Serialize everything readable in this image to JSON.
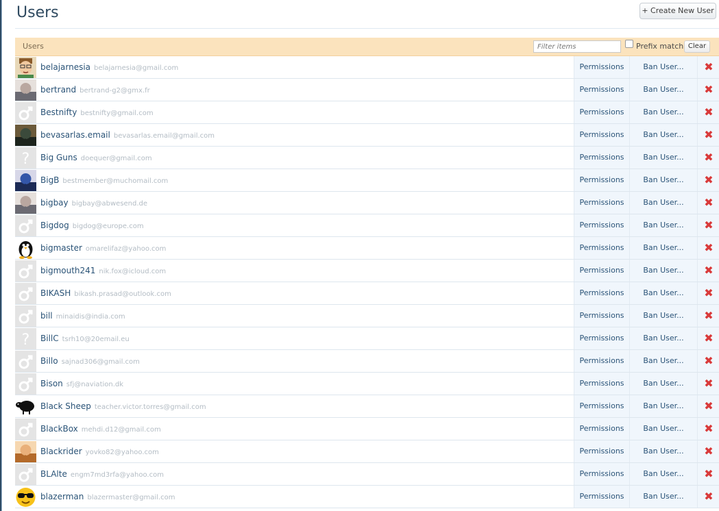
{
  "page": {
    "title": "Users",
    "create_button": "+ Create New User"
  },
  "filter": {
    "section_label": "Users",
    "placeholder": "Filter items",
    "prefix_label": "Prefix match",
    "clear_label": "Clear"
  },
  "row_actions": {
    "permissions": "Permissions",
    "ban": "Ban User...",
    "delete_icon": "red-x-icon"
  },
  "colors": {
    "accent_link": "#2a5377",
    "filter_bar": "#fbe3bd",
    "delete": "#d93a3a"
  },
  "users": [
    {
      "name": "belajarnesia",
      "email": "belajarnesia@gmail.com",
      "avatar": "cartoon-avatar"
    },
    {
      "name": "bertrand",
      "email": "bertrand-g2@gmx.fr",
      "avatar": "photo-avatar"
    },
    {
      "name": "Bestnifty",
      "email": "bestnifty@gmail.com",
      "avatar": "male-default-avatar"
    },
    {
      "name": "bevasarlas.email",
      "email": "bevasarlas.email@gmail.com",
      "avatar": "photo-avatar"
    },
    {
      "name": "Big Guns",
      "email": "doequer@gmail.com",
      "avatar": "unknown-default-avatar"
    },
    {
      "name": "BigB",
      "email": "bestmember@muchomail.com",
      "avatar": "photo-avatar"
    },
    {
      "name": "bigbay",
      "email": "bigbay@abwesend.de",
      "avatar": "photo-avatar"
    },
    {
      "name": "Bigdog",
      "email": "bigdog@europe.com",
      "avatar": "male-default-avatar"
    },
    {
      "name": "bigmaster",
      "email": "omarelifaz@yahoo.com",
      "avatar": "penguin-avatar"
    },
    {
      "name": "bigmouth241",
      "email": "nik.fox@icloud.com",
      "avatar": "male-default-avatar"
    },
    {
      "name": "BIKASH",
      "email": "bikash.prasad@outlook.com",
      "avatar": "male-default-avatar"
    },
    {
      "name": "bill",
      "email": "minaidis@india.com",
      "avatar": "male-default-avatar"
    },
    {
      "name": "BillC",
      "email": "tsrh10@20email.eu",
      "avatar": "unknown-default-avatar"
    },
    {
      "name": "Billo",
      "email": "sajnad306@gmail.com",
      "avatar": "male-default-avatar"
    },
    {
      "name": "Bison",
      "email": "sfj@naviation.dk",
      "avatar": "male-default-avatar"
    },
    {
      "name": "Black Sheep",
      "email": "teacher.victor.torres@gmail.com",
      "avatar": "sheep-avatar"
    },
    {
      "name": "BlackBox",
      "email": "mehdi.d12@gmail.com",
      "avatar": "male-default-avatar"
    },
    {
      "name": "Blackrider",
      "email": "yovko82@yahoo.com",
      "avatar": "photo-avatar"
    },
    {
      "name": "BLAlte",
      "email": "engm7md3rfa@yahoo.com",
      "avatar": "male-default-avatar"
    },
    {
      "name": "blazerman",
      "email": "blazermaster@gmail.com",
      "avatar": "sunglasses-smiley-avatar"
    }
  ]
}
